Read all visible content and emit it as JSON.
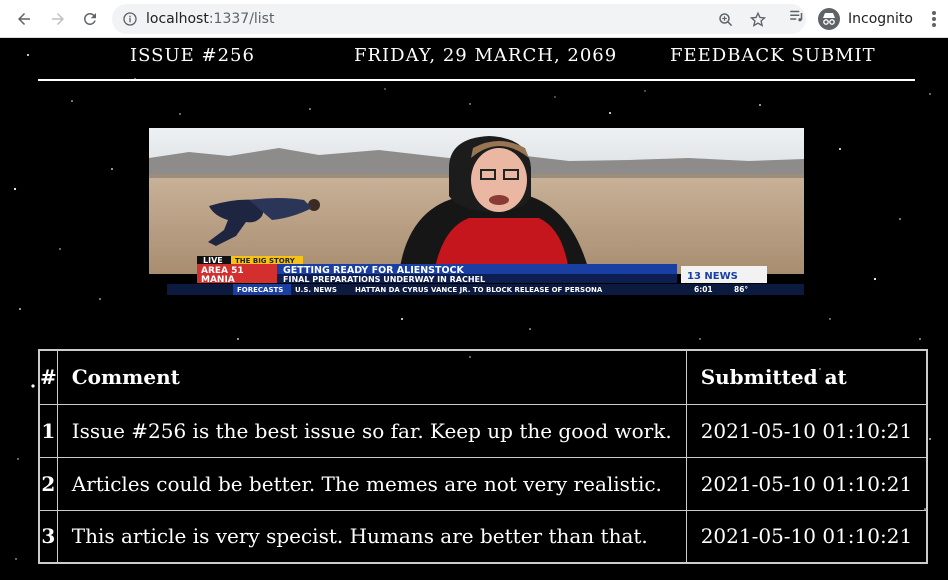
{
  "browser": {
    "url_host": "localhost",
    "url_rest": ":1337/list",
    "profile_label": "Incognito"
  },
  "nav": {
    "issue": "ISSUE #256",
    "date": "FRIDAY, 29 MARCH, 2069",
    "feedback": "FEEDBACK SUBMIT"
  },
  "hero": {
    "live": "LIVE",
    "big_story": "THE BIG STORY",
    "show_name_1": "AREA 51",
    "show_name_2": "MANIA",
    "headline": "GETTING READY FOR ALIENSTOCK",
    "subheadline": "FINAL PREPARATIONS UNDERWAY IN RACHEL",
    "channel": "13 NEWS",
    "ticker_1": "FORECASTS",
    "ticker_2": "U.S. NEWS",
    "ticker_3": "HATTAN DA CYRUS VANCE JR. TO BLOCK RELEASE OF PERSONA",
    "time": "6:01",
    "temp": "86°"
  },
  "table": {
    "headers": [
      "#",
      "Comment",
      "Submitted at"
    ],
    "rows": [
      {
        "num": "1",
        "comment": "Issue #256 is the best issue so far. Keep up the good work.",
        "submitted": "2021-05-10 01:10:21"
      },
      {
        "num": "2",
        "comment": "Articles could be better. The memes are not very realistic.",
        "submitted": "2021-05-10 01:10:21"
      },
      {
        "num": "3",
        "comment": "This article is very specist. Humans are better than that.",
        "submitted": "2021-05-10 01:10:21"
      }
    ]
  }
}
